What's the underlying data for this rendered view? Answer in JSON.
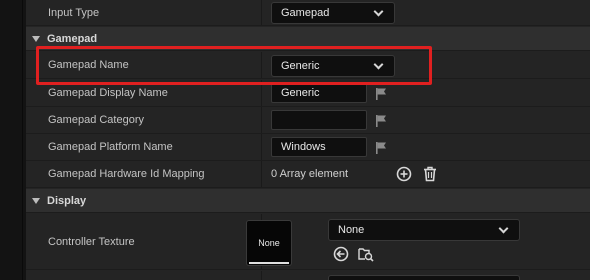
{
  "input_type": {
    "label": "Input Type",
    "value": "Gamepad"
  },
  "section_gamepad": {
    "title": "Gamepad"
  },
  "gamepad_name": {
    "label": "Gamepad Name",
    "value": "Generic"
  },
  "gamepad_display_name": {
    "label": "Gamepad Display Name",
    "value": "Generic"
  },
  "gamepad_category": {
    "label": "Gamepad Category",
    "value": ""
  },
  "gamepad_platform_name": {
    "label": "Gamepad Platform Name",
    "value": "Windows"
  },
  "gamepad_hardware_id_mapping": {
    "label": "Gamepad Hardware Id Mapping",
    "value": "0 Array element"
  },
  "section_display": {
    "title": "Display"
  },
  "controller_texture": {
    "label": "Controller Texture",
    "thumbnail": "None",
    "asset_value": "None"
  },
  "colors": {
    "highlight": "#e02020",
    "panel": "#242424",
    "section": "#2f2f2f",
    "field": "#0f0f0f"
  },
  "icons": [
    "chevron-down-icon",
    "flag-icon",
    "add-icon",
    "trash-icon",
    "arrow-left-circle-icon",
    "browse-folder-icon"
  ]
}
